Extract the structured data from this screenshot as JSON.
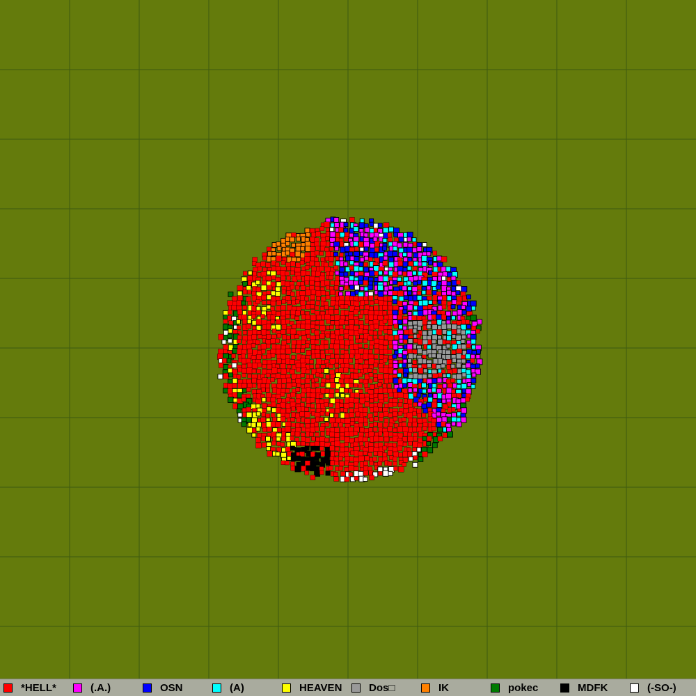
{
  "map": {
    "background_color": "#647b0c",
    "grid_color": "#3d5a10",
    "grid_divisions": 10,
    "world": {
      "center": [
        500,
        500
      ],
      "radius": 187
    },
    "default_territory": "*HELL*"
  },
  "legend": {
    "items": [
      {
        "label": "*HELL*",
        "color": "#ff0000"
      },
      {
        "label": "(.A.)",
        "color": "#ff00ff"
      },
      {
        "label": "OSN",
        "color": "#0000ff"
      },
      {
        "label": "(A)",
        "color": "#00ffff"
      },
      {
        "label": "HEAVEN",
        "color": "#ffff00"
      },
      {
        "label": "Dos□",
        "color": "#999999"
      },
      {
        "label": "IK",
        "color": "#ff8000"
      },
      {
        "label": "pokec",
        "color": "#007a00"
      },
      {
        "label": "MDFK",
        "color": "#000000"
      },
      {
        "label": "(-SO-)",
        "color": "#ffffff"
      }
    ]
  }
}
